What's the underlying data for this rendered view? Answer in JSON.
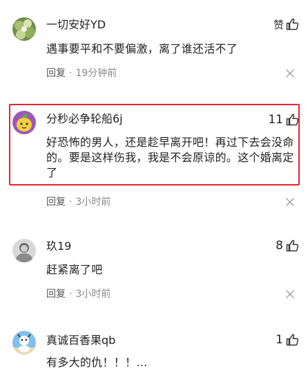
{
  "comments": [
    {
      "username": "一切安好YD",
      "like_label": "赞",
      "content": "遇事要平和不要偏激，离了谁还活不了",
      "reply_label": "回复",
      "time": "19分钟前"
    },
    {
      "username": "分秒必争轮船6j",
      "like_count": "11",
      "content": "好恐怖的男人，还是趁早离开吧！再过下去会没命的。要是这样伤我，我是不会原谅的。这个婚离定了",
      "reply_label": "回复",
      "time": "3小时前",
      "highlight_color": "#e8222e"
    },
    {
      "username": "玖19",
      "like_count": "8",
      "content": "赶紧离了吧",
      "reply_label": "回复",
      "time": "3小时前"
    },
    {
      "username": "真诚百香果qb",
      "like_count": "1",
      "content": "有多大的仇！！！..."
    }
  ],
  "separator": "·",
  "icons": {
    "like": "thumbs-up-icon",
    "report": "x-icon"
  }
}
